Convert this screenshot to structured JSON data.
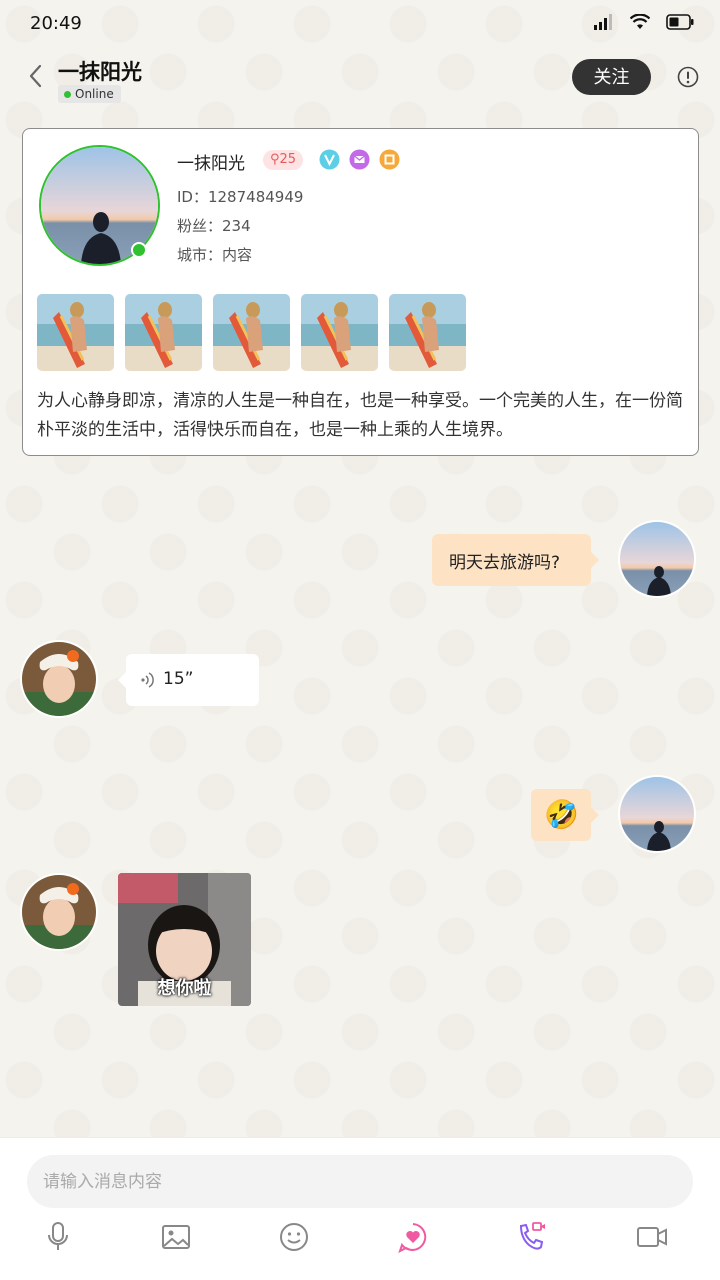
{
  "status_bar": {
    "time": "20:49",
    "icons": [
      "signal-icon",
      "wifi-icon",
      "battery-icon"
    ]
  },
  "header": {
    "title": "一抹阳光",
    "status": "Online",
    "follow_label": "关注",
    "icons": [
      "back-icon",
      "info-icon"
    ]
  },
  "profile": {
    "name": "一抹阳光",
    "level": "25",
    "badges": [
      "vip-v-icon",
      "mail-badge-icon",
      "gold-badge-icon"
    ],
    "id_line": "ID：1287484949",
    "fans_line": "粉丝：234",
    "city_line": "城市：内容",
    "photo_count": 5,
    "bio": "为人心静身即凉，清凉的人生是一种自在，也是一种享受。一个完美的人生，在一份简朴平淡的生活中，活得快乐而自在，也是一种上乘的人生境界。"
  },
  "messages": [
    {
      "side": "right",
      "type": "text",
      "text": "明天去旅游吗?"
    },
    {
      "side": "left",
      "type": "voice",
      "duration": "15”"
    },
    {
      "side": "right",
      "type": "emoji",
      "emoji": "🤣"
    },
    {
      "side": "left",
      "type": "sticker",
      "caption": "想你啦"
    }
  ],
  "input": {
    "placeholder": "请输入消息内容"
  },
  "toolbar": {
    "icons": [
      "microphone-icon",
      "image-icon",
      "emoji-icon",
      "heart-chat-icon",
      "voice-call-icon",
      "video-call-icon"
    ]
  },
  "colors": {
    "online": "#2fc12f",
    "follow_button": "#333333",
    "sent_bubble": "#fde2c4",
    "level_text": "#e85a5a",
    "heart_pink": "#f05aa0",
    "call_purple": "#8a5cf0"
  }
}
